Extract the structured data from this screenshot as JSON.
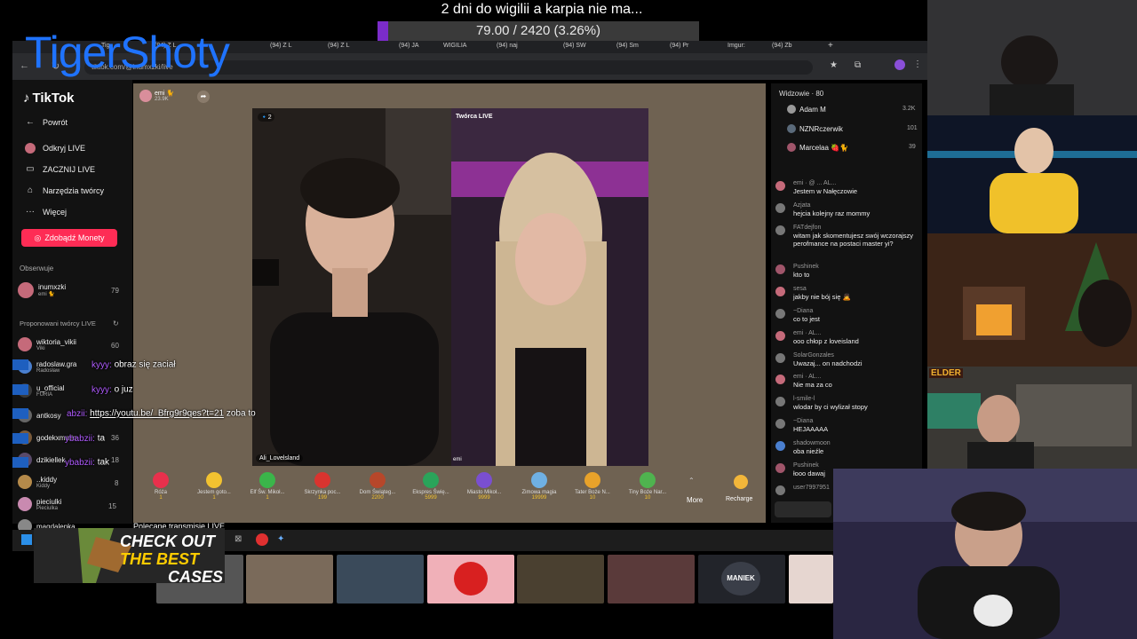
{
  "overlay": {
    "banner": "2 dni do wigilii a karpia nie ma...",
    "progress_text": "79.00 / 2420 (3.26%)",
    "progress_fraction": 0.0326,
    "streamer_name": "TigerShoty"
  },
  "browser": {
    "tabs": [
      "Tig",
      "(94) Z L",
      "(94) JA",
      "WIGILIA",
      "(94) SW",
      "(94) naj",
      "(94) Sm",
      "(94) Pr",
      "Imgur:",
      "(94) Zb"
    ],
    "url": "tiktok.com/@inumxzki/live"
  },
  "sidebar": {
    "logo": "TikTok",
    "items": [
      "Powrót",
      "Odkryj LIVE",
      "ZACZNIJ LIVE",
      "Narzędzia twórcy",
      "Więcej"
    ],
    "coins_button": "Zdobądź Monety",
    "following_label": "Obserwuje",
    "following": [
      {
        "name": "inumxzki",
        "sub": "emi 🐈",
        "count": "79"
      }
    ],
    "suggested_label": "Proponowani twórcy LIVE",
    "suggested": [
      {
        "name": "wiktoria_vikii",
        "sub": "Viki",
        "count": "60"
      },
      {
        "name": "radoslaw.gra",
        "sub": "Radosław",
        "count": ""
      },
      {
        "name": "u_official",
        "sub": "FURIA",
        "count": ""
      },
      {
        "name": "antkosy",
        "sub": "",
        "count": ""
      },
      {
        "name": "godekxmatin",
        "sub": "",
        "count": "36"
      },
      {
        "name": "dzikiellek",
        "sub": "",
        "count": "18"
      },
      {
        "name": "..kiddy",
        "sub": "Kiddy",
        "count": "8"
      },
      {
        "name": "pieciulki",
        "sub": "Pieciulka",
        "count": "15"
      },
      {
        "name": "magdalenka",
        "sub": "",
        "count": ""
      }
    ]
  },
  "live": {
    "host_name": "emi 🐈",
    "host_sub": "23.9K",
    "left_label": "Ali_Lovelsland",
    "right_label": "Twórca LIVE",
    "right_tag": "emi",
    "gifts": [
      {
        "name": "Róża",
        "price": "1",
        "color": "#e8304c"
      },
      {
        "name": "Jestem goto...",
        "price": "1",
        "color": "#f2c230"
      },
      {
        "name": "Elf Św. Mikoł...",
        "price": "1",
        "color": "#3bb54a"
      },
      {
        "name": "Skrzynka poc...",
        "price": "199",
        "color": "#d9342f"
      },
      {
        "name": "Dom Świąteg...",
        "price": "2200",
        "color": "#b7472a"
      },
      {
        "name": "Ekspres Świę...",
        "price": "5999",
        "color": "#2aa45a"
      },
      {
        "name": "Miasto Mikoł...",
        "price": "9999",
        "color": "#7a4fd0"
      },
      {
        "name": "Zimowa magia",
        "price": "19999",
        "color": "#6fb0e3"
      },
      {
        "name": "Tater Boże N...",
        "price": "10",
        "color": "#e8a22a"
      },
      {
        "name": "Tiny Boże Nar...",
        "price": "10",
        "color": "#4fb34f"
      }
    ],
    "more": "More",
    "recharge": "Recharge",
    "recommended_heading": "Polecane transmisje LIVE"
  },
  "chat": {
    "viewers_label": "Widzowie · 80",
    "top_viewers": [
      {
        "name": "Adam M",
        "count": "3.2K"
      },
      {
        "name": "NZNRczerwik",
        "count": "101"
      },
      {
        "name": "Marcelaa 🍓🐈",
        "count": "39"
      }
    ],
    "messages": [
      {
        "name": "emi · @ ... AL...",
        "text": "Jestem w Nałęczowie"
      },
      {
        "name": "Azjata",
        "text": "hejcia kolejny raz mommy"
      },
      {
        "name": "FATdejfon",
        "text": "witam jak skomentujesz swój wczorajszy perofmance na postaci master yi?"
      },
      {
        "name": "Pushinek",
        "text": "kto to"
      },
      {
        "name": "sesa",
        "text": "jakby nie bój się 🙇"
      },
      {
        "name": "~Diana",
        "text": "co to jest"
      },
      {
        "name": "emi · AL...",
        "text": "ooo chłop z loveisland"
      },
      {
        "name": "SolarGonzales",
        "text": "Uwazaj... on nadchodzi"
      },
      {
        "name": "emi · AL...",
        "text": "Nie ma za co"
      },
      {
        "name": "l-smile-l",
        "text": "wlodar by ci wylizał stopy"
      },
      {
        "name": "~Diana",
        "text": "HEJAAAAA"
      },
      {
        "name": "shadowmoon",
        "text": "oba nieźle"
      },
      {
        "name": "Pushinek",
        "text": "łooo dawaj"
      },
      {
        "name": "user7997951",
        "text": ""
      }
    ]
  },
  "overlay_chat": [
    {
      "who": "kyyy:",
      "text": "obraz się zaciał"
    },
    {
      "who": "kyyy:",
      "text": "o juz"
    },
    {
      "who": "abzii:",
      "text": "zoba to",
      "link": "https://youtu.be/_Bfrg9r9qes?t=21"
    },
    {
      "who": "ybabzii:",
      "text": "ta"
    },
    {
      "who": "ybabzii:",
      "text": "tak"
    }
  ],
  "ad": {
    "line1": "CHECK OUT",
    "line2": "THE BEST",
    "line3": "CASES"
  },
  "thumbnails": [
    "stream-1",
    "stream-2",
    "stream-3",
    "stream-4",
    "stream-5",
    "stream-6",
    "stream-7",
    "stream-8"
  ],
  "thumb_label_7": "MANIEK"
}
